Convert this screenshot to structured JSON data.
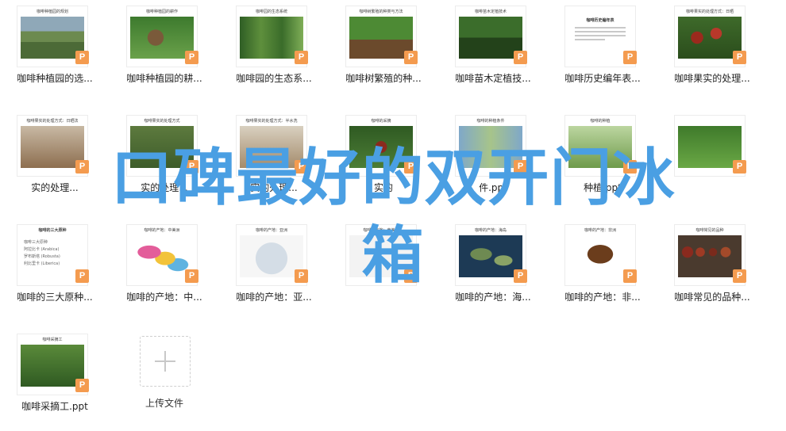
{
  "files": [
    {
      "name": "咖啡种植园的选...",
      "slide_title": "咖啡种植园的规划",
      "icon": "ppt-icon"
    },
    {
      "name": "咖啡种植园的耕...",
      "slide_title": "咖啡种植园的耕作",
      "icon": "ppt-icon"
    },
    {
      "name": "咖啡园的生态系...",
      "slide_title": "咖啡园的生态系统",
      "icon": "ppt-icon"
    },
    {
      "name": "咖啡树繁殖的种...",
      "slide_title": "咖啡树繁殖的种类与方法",
      "icon": "ppt-icon"
    },
    {
      "name": "咖啡苗木定植技...",
      "slide_title": "咖啡苗木定植技术",
      "icon": "ppt-icon"
    },
    {
      "name": "咖啡历史编年表...",
      "slide_title": "咖啡历史编年表",
      "icon": "ppt-icon"
    },
    {
      "name": "咖啡果实的处理...",
      "slide_title": "咖啡果实的处理方式：日晒",
      "icon": "ppt-icon"
    },
    {
      "name": "实的处理...",
      "slide_title": "咖啡果实的处理方式：日晒法",
      "icon": "ppt-icon"
    },
    {
      "name": "实的处理...",
      "slide_title": "咖啡果实的处理方式",
      "icon": "ppt-icon"
    },
    {
      "name": "实的处理...",
      "slide_title": "咖啡果实的处理方式：半水洗",
      "icon": "ppt-icon"
    },
    {
      "name": "实的",
      "slide_title": "咖啡的采摘",
      "icon": "ppt-icon"
    },
    {
      "name": "件.ppt",
      "slide_title": "咖啡的种植条件",
      "icon": "ppt-icon"
    },
    {
      "name": "种植.ppt",
      "slide_title": "咖啡的种植",
      "icon": "ppt-icon"
    },
    {
      "name": "",
      "slide_title": "",
      "icon": "ppt-icon"
    },
    {
      "name": "咖啡的三大原种...",
      "slide_title": "咖啡的三大原种",
      "icon": "ppt-icon"
    },
    {
      "name": "咖啡的产地：中...",
      "slide_title": "咖啡的产地：中美洲",
      "icon": "ppt-icon"
    },
    {
      "name": "咖啡的产地：亚...",
      "slide_title": "咖啡的产地：亚洲",
      "icon": "ppt-icon"
    },
    {
      "name": "",
      "slide_title": "咖啡的产地：南美洲",
      "icon": "ppt-icon"
    },
    {
      "name": "咖啡的产地：海...",
      "slide_title": "咖啡的产地：海岛",
      "icon": "ppt-icon"
    },
    {
      "name": "咖啡的产地：非...",
      "slide_title": "咖啡的产地：非洲",
      "icon": "ppt-icon"
    },
    {
      "name": "咖啡常见的品种...",
      "slide_title": "咖啡常见的品种",
      "icon": "ppt-icon"
    },
    {
      "name": "咖啡采摘工.ppt",
      "slide_title": "咖啡采摘工",
      "icon": "ppt-icon"
    }
  ],
  "upload": {
    "label": "上传文件",
    "icon": "plus-icon"
  },
  "overlay": {
    "title_line1": "口碑最好的双开门冰",
    "title_line2": "箱"
  },
  "doc_bullets": [
    "咖啡三大原种",
    "阿拉比卡 (Arabica)",
    "罗布斯塔 (Robusta)",
    "利比里卡 (Liberica)"
  ],
  "colors": {
    "badge": "#f49b4f",
    "overlay_text": "#4a9fe3"
  }
}
